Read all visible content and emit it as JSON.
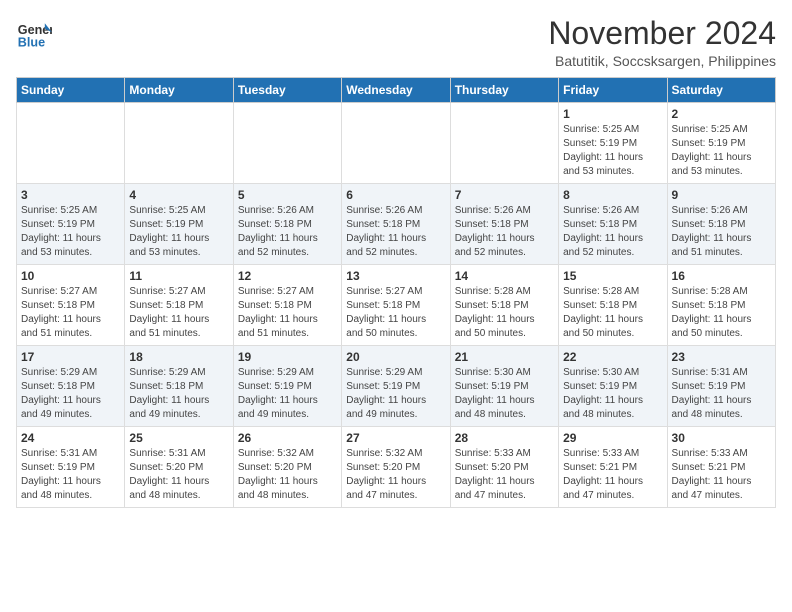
{
  "header": {
    "logo_line1": "General",
    "logo_line2": "Blue",
    "month_year": "November 2024",
    "location": "Batutitik, Soccsksargen, Philippines"
  },
  "weekdays": [
    "Sunday",
    "Monday",
    "Tuesday",
    "Wednesday",
    "Thursday",
    "Friday",
    "Saturday"
  ],
  "weeks": [
    [
      {
        "day": "",
        "info": ""
      },
      {
        "day": "",
        "info": ""
      },
      {
        "day": "",
        "info": ""
      },
      {
        "day": "",
        "info": ""
      },
      {
        "day": "",
        "info": ""
      },
      {
        "day": "1",
        "info": "Sunrise: 5:25 AM\nSunset: 5:19 PM\nDaylight: 11 hours\nand 53 minutes."
      },
      {
        "day": "2",
        "info": "Sunrise: 5:25 AM\nSunset: 5:19 PM\nDaylight: 11 hours\nand 53 minutes."
      }
    ],
    [
      {
        "day": "3",
        "info": "Sunrise: 5:25 AM\nSunset: 5:19 PM\nDaylight: 11 hours\nand 53 minutes."
      },
      {
        "day": "4",
        "info": "Sunrise: 5:25 AM\nSunset: 5:19 PM\nDaylight: 11 hours\nand 53 minutes."
      },
      {
        "day": "5",
        "info": "Sunrise: 5:26 AM\nSunset: 5:18 PM\nDaylight: 11 hours\nand 52 minutes."
      },
      {
        "day": "6",
        "info": "Sunrise: 5:26 AM\nSunset: 5:18 PM\nDaylight: 11 hours\nand 52 minutes."
      },
      {
        "day": "7",
        "info": "Sunrise: 5:26 AM\nSunset: 5:18 PM\nDaylight: 11 hours\nand 52 minutes."
      },
      {
        "day": "8",
        "info": "Sunrise: 5:26 AM\nSunset: 5:18 PM\nDaylight: 11 hours\nand 52 minutes."
      },
      {
        "day": "9",
        "info": "Sunrise: 5:26 AM\nSunset: 5:18 PM\nDaylight: 11 hours\nand 51 minutes."
      }
    ],
    [
      {
        "day": "10",
        "info": "Sunrise: 5:27 AM\nSunset: 5:18 PM\nDaylight: 11 hours\nand 51 minutes."
      },
      {
        "day": "11",
        "info": "Sunrise: 5:27 AM\nSunset: 5:18 PM\nDaylight: 11 hours\nand 51 minutes."
      },
      {
        "day": "12",
        "info": "Sunrise: 5:27 AM\nSunset: 5:18 PM\nDaylight: 11 hours\nand 51 minutes."
      },
      {
        "day": "13",
        "info": "Sunrise: 5:27 AM\nSunset: 5:18 PM\nDaylight: 11 hours\nand 50 minutes."
      },
      {
        "day": "14",
        "info": "Sunrise: 5:28 AM\nSunset: 5:18 PM\nDaylight: 11 hours\nand 50 minutes."
      },
      {
        "day": "15",
        "info": "Sunrise: 5:28 AM\nSunset: 5:18 PM\nDaylight: 11 hours\nand 50 minutes."
      },
      {
        "day": "16",
        "info": "Sunrise: 5:28 AM\nSunset: 5:18 PM\nDaylight: 11 hours\nand 50 minutes."
      }
    ],
    [
      {
        "day": "17",
        "info": "Sunrise: 5:29 AM\nSunset: 5:18 PM\nDaylight: 11 hours\nand 49 minutes."
      },
      {
        "day": "18",
        "info": "Sunrise: 5:29 AM\nSunset: 5:18 PM\nDaylight: 11 hours\nand 49 minutes."
      },
      {
        "day": "19",
        "info": "Sunrise: 5:29 AM\nSunset: 5:19 PM\nDaylight: 11 hours\nand 49 minutes."
      },
      {
        "day": "20",
        "info": "Sunrise: 5:29 AM\nSunset: 5:19 PM\nDaylight: 11 hours\nand 49 minutes."
      },
      {
        "day": "21",
        "info": "Sunrise: 5:30 AM\nSunset: 5:19 PM\nDaylight: 11 hours\nand 48 minutes."
      },
      {
        "day": "22",
        "info": "Sunrise: 5:30 AM\nSunset: 5:19 PM\nDaylight: 11 hours\nand 48 minutes."
      },
      {
        "day": "23",
        "info": "Sunrise: 5:31 AM\nSunset: 5:19 PM\nDaylight: 11 hours\nand 48 minutes."
      }
    ],
    [
      {
        "day": "24",
        "info": "Sunrise: 5:31 AM\nSunset: 5:19 PM\nDaylight: 11 hours\nand 48 minutes."
      },
      {
        "day": "25",
        "info": "Sunrise: 5:31 AM\nSunset: 5:20 PM\nDaylight: 11 hours\nand 48 minutes."
      },
      {
        "day": "26",
        "info": "Sunrise: 5:32 AM\nSunset: 5:20 PM\nDaylight: 11 hours\nand 48 minutes."
      },
      {
        "day": "27",
        "info": "Sunrise: 5:32 AM\nSunset: 5:20 PM\nDaylight: 11 hours\nand 47 minutes."
      },
      {
        "day": "28",
        "info": "Sunrise: 5:33 AM\nSunset: 5:20 PM\nDaylight: 11 hours\nand 47 minutes."
      },
      {
        "day": "29",
        "info": "Sunrise: 5:33 AM\nSunset: 5:21 PM\nDaylight: 11 hours\nand 47 minutes."
      },
      {
        "day": "30",
        "info": "Sunrise: 5:33 AM\nSunset: 5:21 PM\nDaylight: 11 hours\nand 47 minutes."
      }
    ]
  ]
}
